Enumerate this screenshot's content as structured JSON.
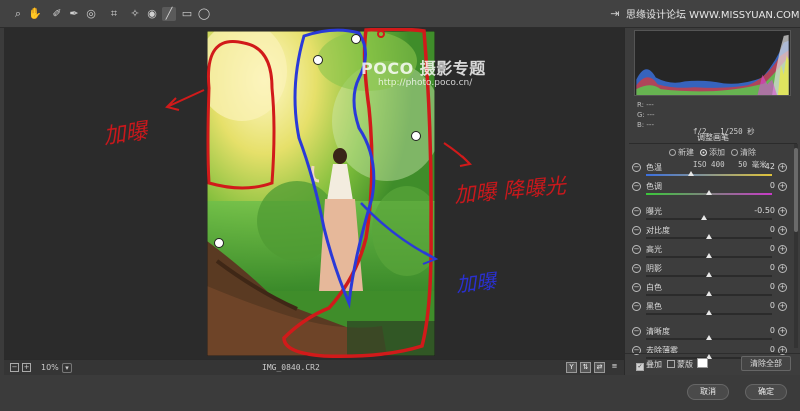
{
  "toolbar": {
    "tools": [
      "zoom-tool",
      "hand-tool",
      "white-balance-tool",
      "color-sampler-tool",
      "targeted-adjustment-tool",
      "crop-tool",
      "spot-removal-tool",
      "red-eye-tool",
      "adjustment-brush-tool",
      "graduated-filter-tool",
      "radial-filter-tool"
    ],
    "watermark": "思缘设计论坛 WWW.MISSYUAN.COM"
  },
  "preview": {
    "overlay_logo": "POCO 摄影专题",
    "overlay_url": "http://photo.poco.cn/",
    "annotations": {
      "left": "加曝",
      "right": "加曝 降曝光",
      "bottom": "加曝"
    }
  },
  "status": {
    "zoom": "10%",
    "filename": "IMG_0840.CR2"
  },
  "panel": {
    "rgb": {
      "r": "R: ---",
      "g": "G: ---",
      "b": "B: ---"
    },
    "camera_line1": "f/2   1/250 秒",
    "camera_line2": "ISO 400   50 毫米",
    "section_title": "调整画笔",
    "modes": {
      "new": "新建",
      "add": "添加",
      "clear": "清除",
      "selected": "add"
    },
    "sliders": [
      {
        "label": "色温",
        "value": "-42",
        "pos": 0.36
      },
      {
        "label": "色调",
        "value": "0",
        "pos": 0.5
      },
      {
        "label": "曝光",
        "value": "-0.50",
        "pos": 0.46
      },
      {
        "label": "对比度",
        "value": "0",
        "pos": 0.5
      },
      {
        "label": "高光",
        "value": "0",
        "pos": 0.5
      },
      {
        "label": "阴影",
        "value": "0",
        "pos": 0.5
      },
      {
        "label": "白色",
        "value": "0",
        "pos": 0.5
      },
      {
        "label": "黑色",
        "value": "0",
        "pos": 0.5
      },
      {
        "label": "清晰度",
        "value": "0",
        "pos": 0.5
      },
      {
        "label": "去除薄雾",
        "value": "0",
        "pos": 0.5
      }
    ],
    "overlay_label": "叠加",
    "overlay_checked": true,
    "mask_label": "蒙版",
    "mask_checked": false,
    "clear_all": "清除全部"
  },
  "dialog": {
    "cancel": "取消",
    "ok": "确定"
  }
}
